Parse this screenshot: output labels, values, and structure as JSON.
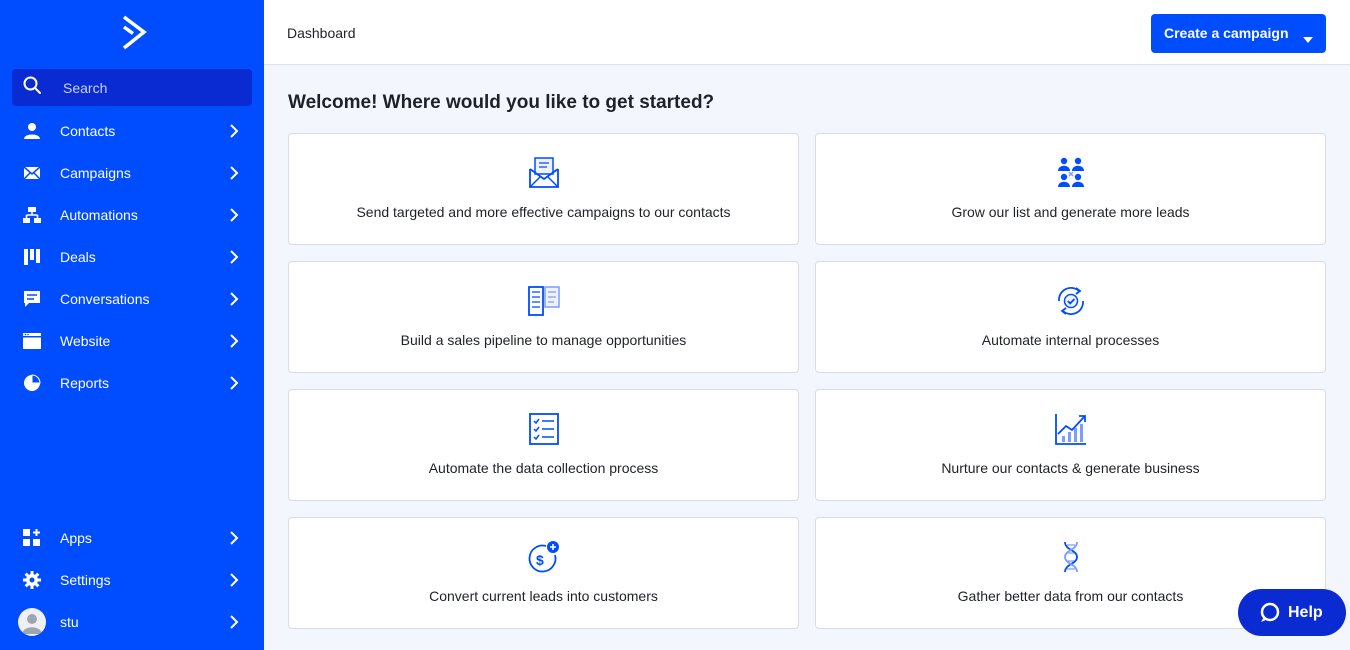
{
  "sidebar": {
    "search_placeholder": "Search",
    "items": [
      {
        "label": "Contacts",
        "icon": "person-icon"
      },
      {
        "label": "Campaigns",
        "icon": "envelope-icon"
      },
      {
        "label": "Automations",
        "icon": "flowchart-icon"
      },
      {
        "label": "Deals",
        "icon": "kanban-icon"
      },
      {
        "label": "Conversations",
        "icon": "chat-icon"
      },
      {
        "label": "Website",
        "icon": "browser-icon"
      },
      {
        "label": "Reports",
        "icon": "pie-chart-icon"
      }
    ],
    "bottom_items": [
      {
        "label": "Apps",
        "icon": "apps-grid-icon"
      },
      {
        "label": "Settings",
        "icon": "gear-icon"
      },
      {
        "label": "stu",
        "icon": "avatar"
      }
    ]
  },
  "header": {
    "title": "Dashboard",
    "cta_label": "Create a campaign"
  },
  "main": {
    "welcome": "Welcome! Where would you like to get started?",
    "cards": [
      {
        "label": "Send targeted and more effective campaigns to our contacts",
        "icon": "email-campaign-icon"
      },
      {
        "label": "Grow our list and generate more leads",
        "icon": "people-group-icon"
      },
      {
        "label": "Build a sales pipeline to manage opportunities",
        "icon": "pipeline-icon"
      },
      {
        "label": "Automate internal processes",
        "icon": "sync-check-icon"
      },
      {
        "label": "Automate the data collection process",
        "icon": "checklist-icon"
      },
      {
        "label": "Nurture our contacts & generate business",
        "icon": "growth-chart-icon"
      },
      {
        "label": "Convert current leads into customers",
        "icon": "dollar-plus-icon"
      },
      {
        "label": "Gather better data from our contacts",
        "icon": "dna-icon"
      }
    ]
  },
  "help": {
    "label": "Help"
  },
  "colors": {
    "brand": "#004cff",
    "sidebar_dark": "#0a2bd1",
    "background": "#f4f6fd"
  }
}
